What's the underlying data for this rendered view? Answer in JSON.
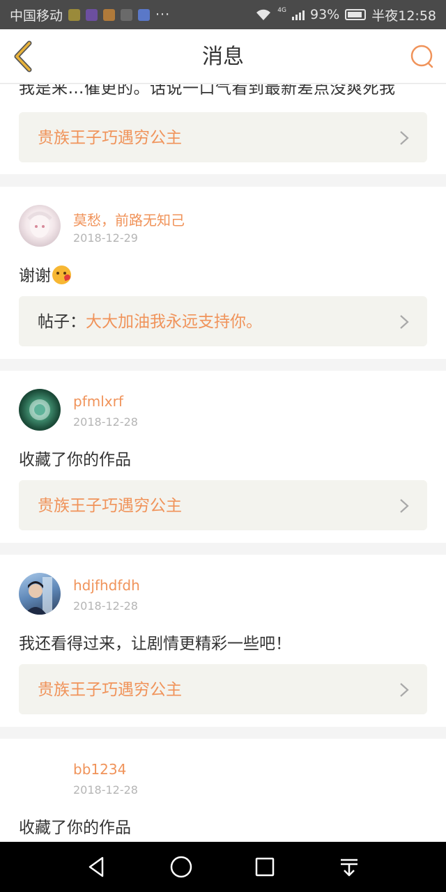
{
  "status_bar": {
    "carrier": "中国移动",
    "more_glyph": "···",
    "network_type": "4G",
    "battery_percent": "93%",
    "time": "半夜12:58",
    "app_icon_colors": [
      "#9a8a3a",
      "#6c4fa0",
      "#b07a3a",
      "#6a6a6a",
      "#5a78c8"
    ]
  },
  "header": {
    "title": "消息",
    "back_icon": "chevron-left-icon",
    "search_icon": "search-icon",
    "accent_color": "#f0935a",
    "back_color": "#e8b23a"
  },
  "messages": [
    {
      "partial_text": "我是来…催更的。话说一口气看到最新差点没爽死我",
      "reference": {
        "prefix": "",
        "title": "贵族王子巧遇穷公主"
      }
    },
    {
      "username": "莫愁，前路无知己",
      "date": "2018-12-29",
      "text": "谢谢",
      "emoji": "kiss-face-emoji",
      "reference": {
        "prefix": "帖子：",
        "title": "大大加油我永远支持你。"
      }
    },
    {
      "username": "pfmlxrf",
      "date": "2018-12-28",
      "text": "收藏了你的作品",
      "reference": {
        "prefix": "",
        "title": "贵族王子巧遇穷公主"
      }
    },
    {
      "username": "hdjfhdfdh",
      "date": "2018-12-28",
      "text": "我还看得过来，让剧情更精彩一些吧！",
      "reference": {
        "prefix": "",
        "title": "贵族王子巧遇穷公主"
      }
    },
    {
      "username": "bb1234",
      "date": "2018-12-28",
      "text": "收藏了你的作品"
    }
  ],
  "nav_bar": {
    "buttons": [
      "back-triangle-icon",
      "home-circle-icon",
      "recents-square-icon",
      "dropdown-icon"
    ]
  }
}
